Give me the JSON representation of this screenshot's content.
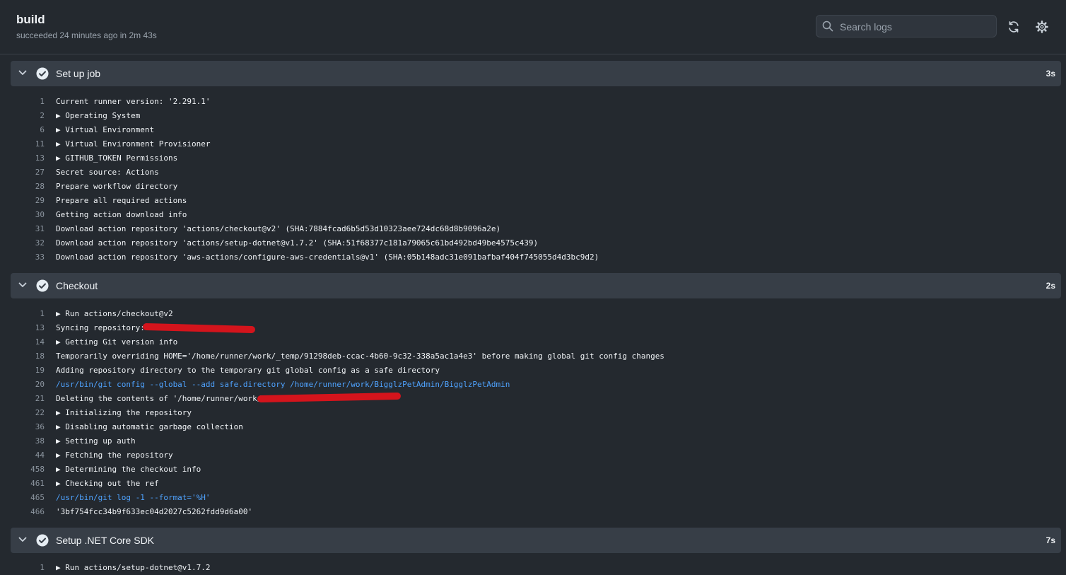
{
  "header": {
    "title": "build",
    "subtitle": "succeeded 24 minutes ago in 2m 43s",
    "search_placeholder": "Search logs"
  },
  "steps": [
    {
      "name": "Set up job",
      "duration": "3s",
      "lines": [
        {
          "num": "1",
          "text": "Current runner version: '2.291.1'"
        },
        {
          "num": "2",
          "text": "▶ Operating System"
        },
        {
          "num": "6",
          "text": "▶ Virtual Environment"
        },
        {
          "num": "11",
          "text": "▶ Virtual Environment Provisioner"
        },
        {
          "num": "13",
          "text": "▶ GITHUB_TOKEN Permissions"
        },
        {
          "num": "27",
          "text": "Secret source: Actions"
        },
        {
          "num": "28",
          "text": "Prepare workflow directory"
        },
        {
          "num": "29",
          "text": "Prepare all required actions"
        },
        {
          "num": "30",
          "text": "Getting action download info"
        },
        {
          "num": "31",
          "text": "Download action repository 'actions/checkout@v2' (SHA:7884fcad6b5d53d10323aee724dc68d8b9096a2e)"
        },
        {
          "num": "32",
          "text": "Download action repository 'actions/setup-dotnet@v1.7.2' (SHA:51f68377c181a79065c61bd492bd49be4575c439)"
        },
        {
          "num": "33",
          "text": "Download action repository 'aws-actions/configure-aws-credentials@v1' (SHA:05b148adc31e091bafbaf404f745055d4d3bc9d2)"
        }
      ]
    },
    {
      "name": "Checkout",
      "duration": "2s",
      "lines": [
        {
          "num": "1",
          "text": "▶ Run actions/checkout@v2"
        },
        {
          "num": "13",
          "text": "Syncing repository: "
        },
        {
          "num": "14",
          "text": "▶ Getting Git version info"
        },
        {
          "num": "18",
          "text": "Temporarily overriding HOME='/home/runner/work/_temp/91298deb-ccac-4b60-9c32-338a5ac1a4e3' before making global git config changes"
        },
        {
          "num": "19",
          "text": "Adding repository directory to the temporary git global config as a safe directory"
        },
        {
          "num": "20",
          "text": "/usr/bin/git config --global --add safe.directory /home/runner/work/BigglzPetAdmin/BigglzPetAdmin",
          "cmd": true
        },
        {
          "num": "21",
          "text": "Deleting the contents of '/home/runner/work/"
        },
        {
          "num": "22",
          "text": "▶ Initializing the repository"
        },
        {
          "num": "36",
          "text": "▶ Disabling automatic garbage collection"
        },
        {
          "num": "38",
          "text": "▶ Setting up auth"
        },
        {
          "num": "44",
          "text": "▶ Fetching the repository"
        },
        {
          "num": "458",
          "text": "▶ Determining the checkout info"
        },
        {
          "num": "461",
          "text": "▶ Checking out the ref"
        },
        {
          "num": "465",
          "text": "/usr/bin/git log -1 --format='%H'",
          "cmd": true
        },
        {
          "num": "466",
          "text": "'3bf754fcc34b9f633ec04d2027c5262fdd9d6a00'"
        }
      ]
    },
    {
      "name": "Setup .NET Core SDK",
      "duration": "7s",
      "lines": [
        {
          "num": "1",
          "text": "▶ Run actions/setup-dotnet@v1.7.2"
        }
      ]
    }
  ],
  "icons": {
    "search": "search-icon",
    "refresh": "refresh-icon",
    "settings": "gear-icon",
    "check": "check-circle-icon",
    "chevron": "chevron-down-icon"
  },
  "colors": {
    "background": "#24292f",
    "step_header": "#373e47",
    "command_text": "#4fa3ff",
    "redaction": "#d4141c"
  }
}
